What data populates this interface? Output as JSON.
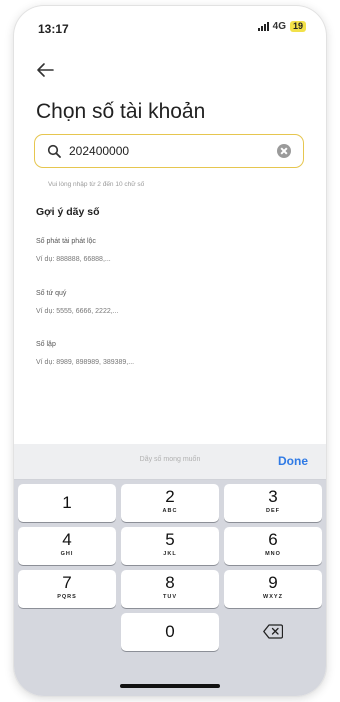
{
  "status_bar": {
    "time": "13:17",
    "network": "4G",
    "battery": "19"
  },
  "page": {
    "title": "Chọn số tài khoản"
  },
  "search": {
    "value": "202400000",
    "hint": "Vui lòng nhập từ 2 đến 10 chữ số"
  },
  "suggestions": {
    "title": "Gợi ý dãy số",
    "items": [
      {
        "name": "Số phát tài phát lộc",
        "example": "Ví dụ: 888888, 66888,..."
      },
      {
        "name": "Số tứ quý",
        "example": "Ví dụ: 5555, 6666, 2222,..."
      },
      {
        "name": "Số lặp",
        "example": "Ví dụ: 8989, 898989, 389389,..."
      }
    ]
  },
  "keyboard": {
    "placeholder": "Dãy số mong muốn",
    "done_label": "Done",
    "keys": [
      {
        "digit": "1",
        "letters": ""
      },
      {
        "digit": "2",
        "letters": "ABC"
      },
      {
        "digit": "3",
        "letters": "DEF"
      },
      {
        "digit": "4",
        "letters": "GHI"
      },
      {
        "digit": "5",
        "letters": "JKL"
      },
      {
        "digit": "6",
        "letters": "MNO"
      },
      {
        "digit": "7",
        "letters": "PQRS"
      },
      {
        "digit": "8",
        "letters": "TUV"
      },
      {
        "digit": "9",
        "letters": "WXYZ"
      },
      {
        "digit": "0",
        "letters": ""
      }
    ]
  },
  "colors": {
    "accent": "#e6c64f",
    "done": "#2f7ae5",
    "keyboard_bg": "#d5d7de"
  }
}
